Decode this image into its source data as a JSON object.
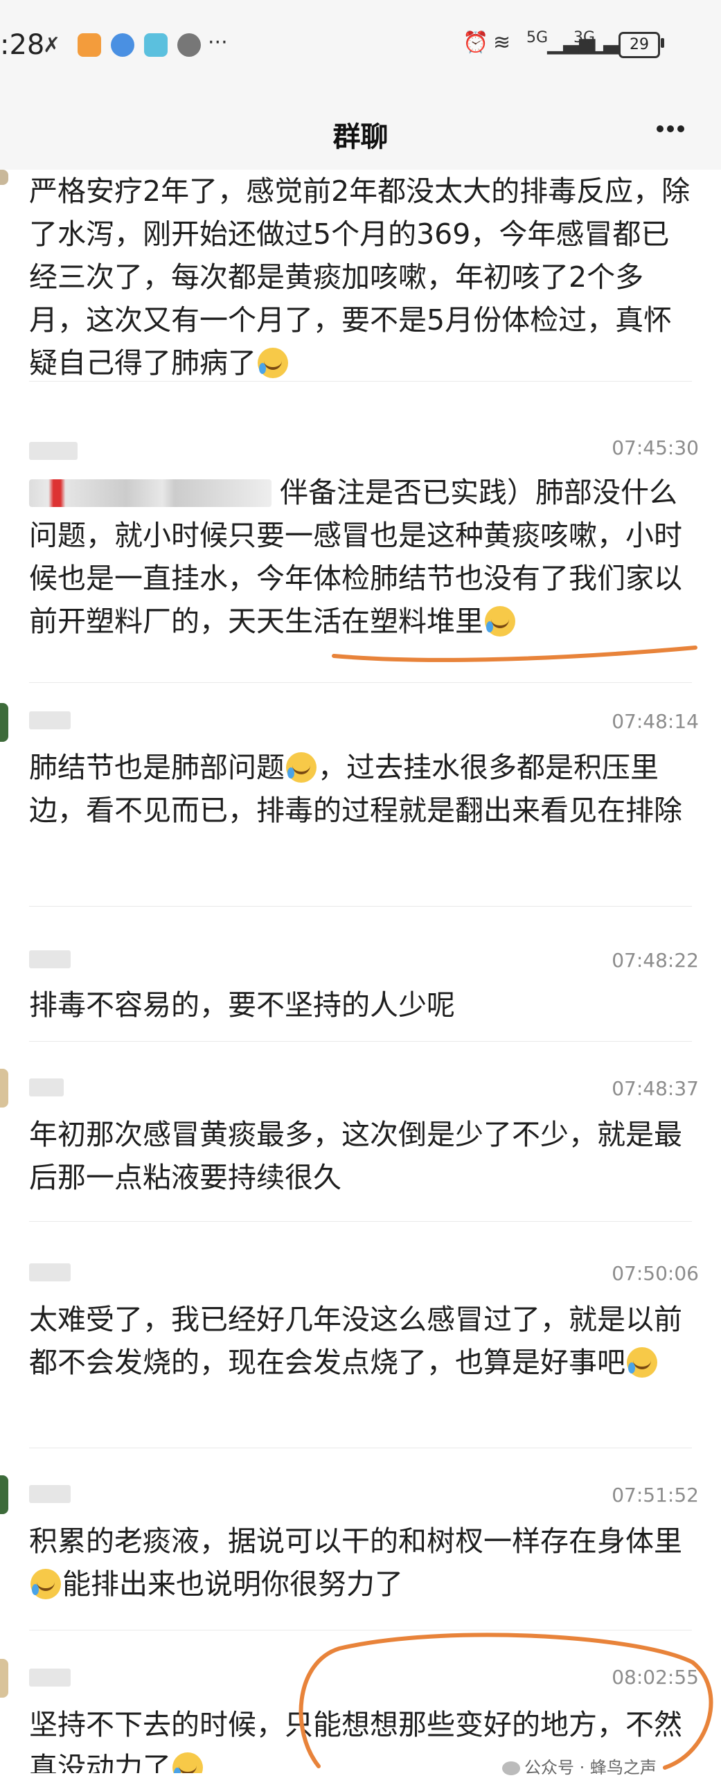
{
  "status_bar": {
    "time": ":28",
    "battery": "29",
    "net1": "5G",
    "net2": "3G"
  },
  "header": {
    "title": "群聊"
  },
  "messages": [
    {
      "time": "",
      "text": "严格安疗2年了，感觉前2年都没太大的排毒反应，除了水泻，刚开始还做过5个月的369，今年感冒都已经三次了，每次都是黄痰加咳嗽，年初咳了2个多月，这次又有一个月了，要不是5月份体检过，真怀疑自己得了肺病了"
    },
    {
      "time": "07:45:30",
      "text_visible": "伴备注是否已实践）肺部没什么问题，就小时候只要一感冒也是这种黄痰咳嗽，小时候也是一直挂水，今年体检肺结节也没有了我们家以前开塑料厂的，天天生活在塑料堆里"
    },
    {
      "time": "07:48:14",
      "text": "肺结节也是肺部问题",
      "text2": "，过去挂水很多都是积压里边，看不见而已，排毒的过程就是翻出来看见在排除"
    },
    {
      "time": "07:48:22",
      "text": "排毒不容易的，要不坚持的人少呢"
    },
    {
      "time": "07:48:37",
      "text": "年初那次感冒黄痰最多，这次倒是少了不少，就是最后那一点粘液要持续很久"
    },
    {
      "time": "07:50:06",
      "text": "太难受了，我已经好几年没这么感冒过了，就是以前都不会发烧的，现在会发点烧了，也算是好事吧"
    },
    {
      "time": "07:51:52",
      "text": "积累的老痰液，据说可以干的和树杈一样存在身体里",
      "text2": "能排出来也说明你很努力了"
    },
    {
      "time": "08:02:55",
      "text": "坚持不下去的时候，只能想想那些变好的地方，不然真没动力了"
    }
  ],
  "watermark": "公众号 · 蜂鸟之声",
  "colors": {
    "annotation": "#e8833a",
    "background": "#ffffff",
    "bar": "#f6f6f6"
  }
}
